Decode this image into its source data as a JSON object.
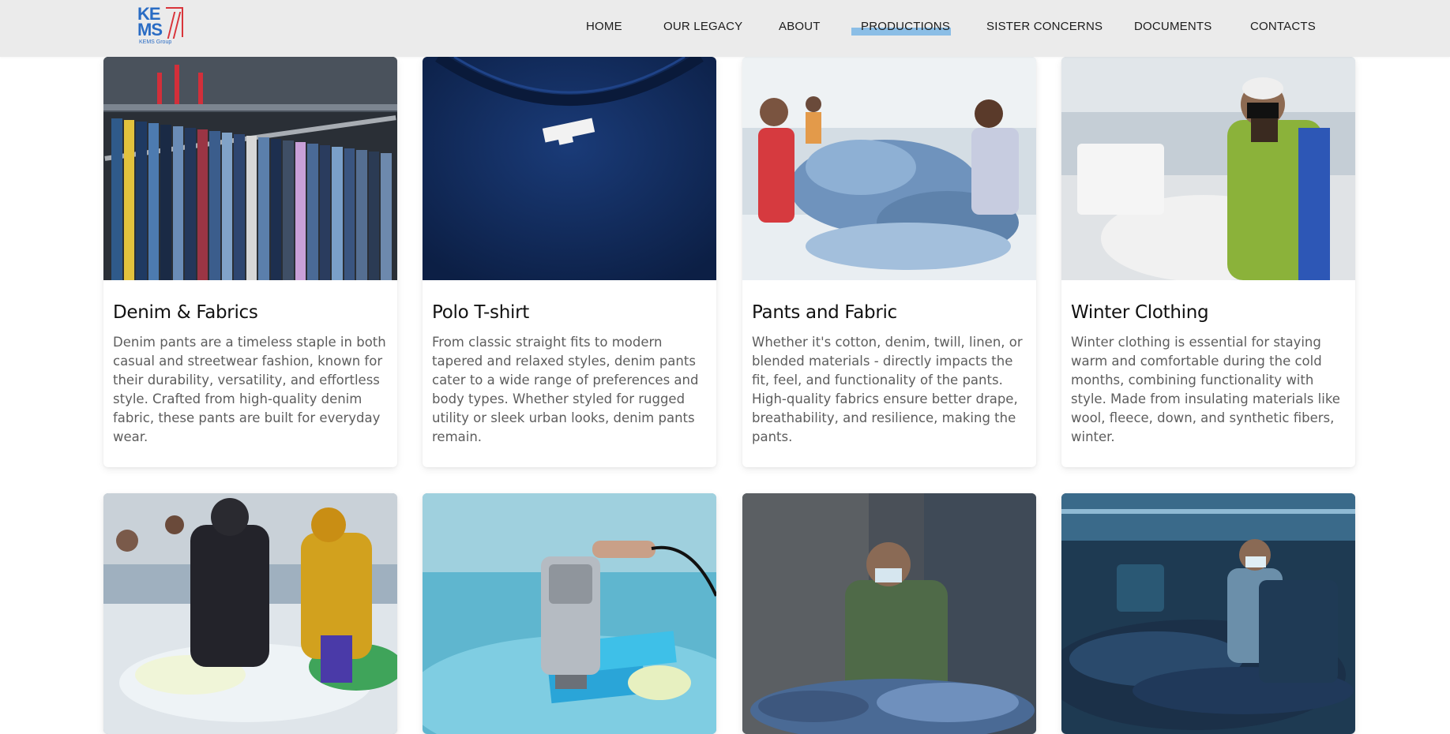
{
  "brand": {
    "logo_line1": "KE",
    "logo_line2": "MS",
    "logo_subtitle": "KEMS Group",
    "primary_color": "#2a6cc4",
    "accent_color": "#d9343a"
  },
  "nav": {
    "items": [
      {
        "label": "HOME"
      },
      {
        "label": "OUR LEGACY"
      },
      {
        "label": "ABOUT"
      },
      {
        "label": "PRODUCTIONS",
        "active": true
      },
      {
        "label": "SISTER CONCERNS"
      },
      {
        "label": "DOCUMENTS"
      },
      {
        "label": "CONTACTS"
      }
    ],
    "active_underline_color": "#86bce6"
  },
  "cards": [
    {
      "title": "Denim & Fabrics",
      "description": "Denim pants are a timeless staple in both casual and streetwear fashion, known for their durability, versatility, and effortless style. Crafted from high-quality denim fabric, these pants are built for everyday wear.",
      "image_subject": "jeans-on-hangers-photo"
    },
    {
      "title": "Polo T-shirt",
      "description": "From classic straight fits to modern tapered and relaxed styles, denim pants cater to a wide range of preferences and body types. Whether styled for rugged utility or sleek urban looks, denim pants remain.",
      "image_subject": "navy-polo-tshirt-photo"
    },
    {
      "title": "Pants and Fabric",
      "description": "Whether it's cotton, denim, twill, linen, or blended materials - directly impacts the fit, feel, and functionality of the pants. High-quality fabrics ensure better drape, breathability, and resilience, making the pants.",
      "image_subject": "factory-workers-sorting-denim-photo"
    },
    {
      "title": "Winter Clothing",
      "description": "Winter clothing is essential for staying warm and comfortable during the cold months, combining functionality with style. Made from insulating materials like wool, fleece, down, and synthetic fibers, winter.",
      "image_subject": "garment-worker-sewing-photo"
    },
    {
      "image_subject": "workers-sorting-printed-fabric-photo"
    },
    {
      "image_subject": "heat-gun-on-tshirt-print-photo"
    },
    {
      "image_subject": "worker-marking-denim-photo"
    },
    {
      "image_subject": "worker-holding-denim-jacket-photo"
    }
  ]
}
